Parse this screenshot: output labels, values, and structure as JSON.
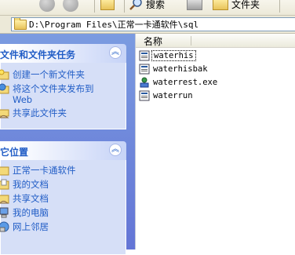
{
  "toolbar": {
    "search_label": "搜索",
    "folders_label": "文件夹"
  },
  "address": {
    "path": "D:\\Program Files\\正常一卡通软件\\sql"
  },
  "task_pane": {
    "file_tasks": {
      "title": "文件和文件夹任务",
      "items": [
        {
          "label": "创建一个新文件夹",
          "icon": "new-folder-icon"
        },
        {
          "label": "将这个文件夹发布到 Web",
          "icon": "publish-web-icon"
        },
        {
          "label": "共享此文件夹",
          "icon": "share-icon"
        }
      ]
    },
    "other_places": {
      "title": "其它位置",
      "items": [
        {
          "label": "正常一卡通软件",
          "icon": "folder-icon"
        },
        {
          "label": "我的文档",
          "icon": "my-documents-icon"
        },
        {
          "label": "共享文档",
          "icon": "shared-documents-icon"
        },
        {
          "label": "我的电脑",
          "icon": "my-computer-icon"
        },
        {
          "label": "网上邻居",
          "icon": "network-places-icon"
        }
      ]
    }
  },
  "file_list": {
    "column_name": "名称",
    "files": [
      {
        "name": "waterhis",
        "icon": "sql-file-icon",
        "selected": true
      },
      {
        "name": "waterhisbak",
        "icon": "sql-file-icon",
        "selected": false
      },
      {
        "name": "waterrest.exe",
        "icon": "exe-app-icon",
        "selected": false
      },
      {
        "name": "waterrun",
        "icon": "sql-file-icon",
        "selected": false
      }
    ]
  }
}
